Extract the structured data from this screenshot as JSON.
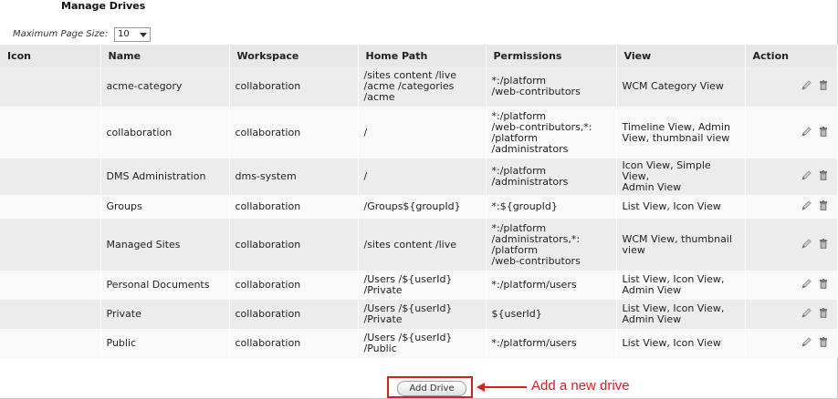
{
  "page": {
    "title": "Manage Drives"
  },
  "page_size": {
    "label": "Maximum Page Size:",
    "value": "10"
  },
  "table": {
    "headers": [
      "Icon",
      "Name",
      "Workspace",
      "Home Path",
      "Permissions",
      "View",
      "Action"
    ],
    "rows": [
      {
        "name": "acme-category",
        "workspace": "collaboration",
        "home_path": [
          "/sites content /live",
          "/acme /categories",
          "/acme"
        ],
        "permissions": [
          "*:/platform",
          "/web-contributors"
        ],
        "view": [
          "WCM Category View"
        ]
      },
      {
        "name": "collaboration",
        "workspace": "collaboration",
        "home_path": [
          "/"
        ],
        "permissions": [
          "*:/platform",
          "/web-contributors,*:",
          "/platform",
          "/administrators"
        ],
        "view": [
          "Timeline View, Admin",
          "View, thumbnail view"
        ]
      },
      {
        "name": "DMS Administration",
        "workspace": "dms-system",
        "home_path": [
          "/"
        ],
        "permissions": [
          "*:/platform",
          "/administrators"
        ],
        "view": [
          "Icon View, Simple View,",
          "Admin View"
        ]
      },
      {
        "name": "Groups",
        "workspace": "collaboration",
        "home_path": [
          "/Groups${groupId}"
        ],
        "permissions": [
          "*:${groupId}"
        ],
        "view": [
          "List View, Icon View"
        ]
      },
      {
        "name": "Managed Sites",
        "workspace": "collaboration",
        "home_path": [
          "/sites content /live"
        ],
        "permissions": [
          "*:/platform",
          "/administrators,*:",
          "/platform",
          "/web-contributors"
        ],
        "view": [
          "WCM View, thumbnail",
          "view"
        ]
      },
      {
        "name": "Personal Documents",
        "workspace": "collaboration",
        "home_path": [
          "/Users /${userId}",
          "/Private"
        ],
        "permissions": [
          "*:/platform/users"
        ],
        "view": [
          "List View, Icon View,",
          "Admin View"
        ]
      },
      {
        "name": "Private",
        "workspace": "collaboration",
        "home_path": [
          "/Users /${userId}",
          "/Private"
        ],
        "permissions": [
          "${userId}"
        ],
        "view": [
          "List View, Icon View,",
          "Admin View"
        ]
      },
      {
        "name": "Public",
        "workspace": "collaboration",
        "home_path": [
          "/Users /${userId}",
          "/Public"
        ],
        "permissions": [
          "*:/platform/users"
        ],
        "view": [
          "List View, Icon View"
        ]
      }
    ]
  },
  "actions": {
    "edit_icon": "pencil-icon",
    "delete_icon": "trash-icon"
  },
  "footer": {
    "add_drive_label": "Add Drive"
  },
  "annotation": {
    "text": "Add a new drive",
    "color": "#d42020"
  }
}
